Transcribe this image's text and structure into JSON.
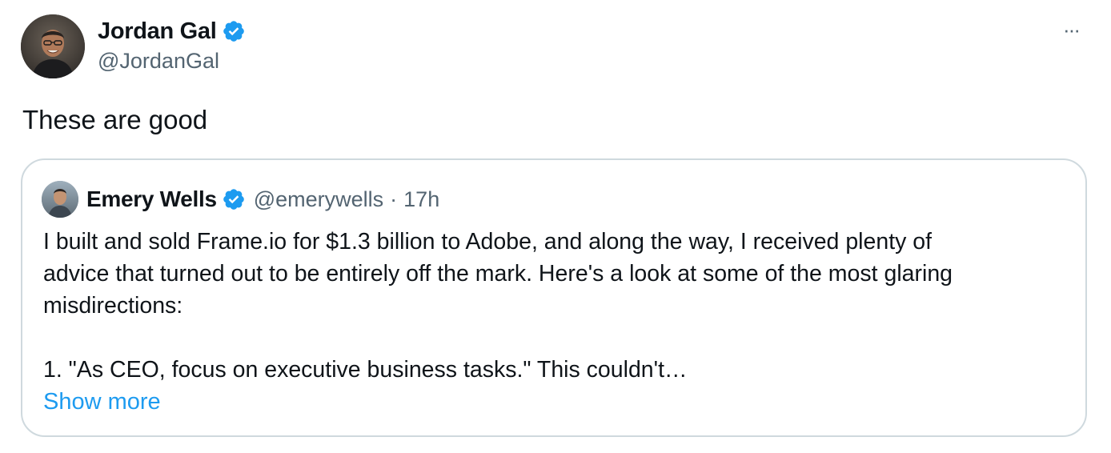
{
  "tweet": {
    "author": {
      "name": "Jordan Gal",
      "handle": "@JordanGal",
      "verified": true
    },
    "more_label": "···",
    "text": "These are good"
  },
  "quote": {
    "author": {
      "name": "Emery Wells",
      "handle": "@emerywells",
      "verified": true
    },
    "separator": "·",
    "time": "17h",
    "body_lines": [
      "I built and sold Frame.io for $1.3 billion to Adobe, and along the way, I received plenty of",
      "advice that turned out to be entirely off the mark. Here's a look at some of the most glaring",
      "misdirections:",
      "1. \"As CEO, focus on executive business tasks.\" This couldn't…"
    ],
    "show_more_label": "Show more"
  },
  "colors": {
    "text_primary": "#0f1419",
    "text_secondary": "#536471",
    "link": "#1d9bf0",
    "verified_badge": "#1d9bf0",
    "card_border": "#cfd9de"
  },
  "icons": {
    "verified": "verified-badge-icon",
    "more": "more-horizontal-icon"
  }
}
